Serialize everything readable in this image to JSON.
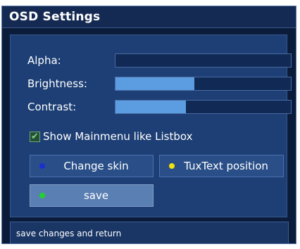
{
  "window": {
    "title": "OSD Settings"
  },
  "settings": {
    "alpha": {
      "label": "Alpha:",
      "value": 0
    },
    "brightness": {
      "label": "Brightness:",
      "value": 0.45
    },
    "contrast": {
      "label": "Contrast:",
      "value": 0.4
    }
  },
  "checkbox": {
    "label": "Show Mainmenu like Listbox",
    "checked": true
  },
  "buttons": {
    "change_skin": {
      "label": "Change skin",
      "dot_color": "#1a2fd0"
    },
    "tuxtext": {
      "label": "TuxText position",
      "dot_color": "#f2e20f"
    },
    "save": {
      "label": "save",
      "dot_color": "#1fd42a"
    }
  },
  "status": {
    "text": "save changes and return"
  }
}
